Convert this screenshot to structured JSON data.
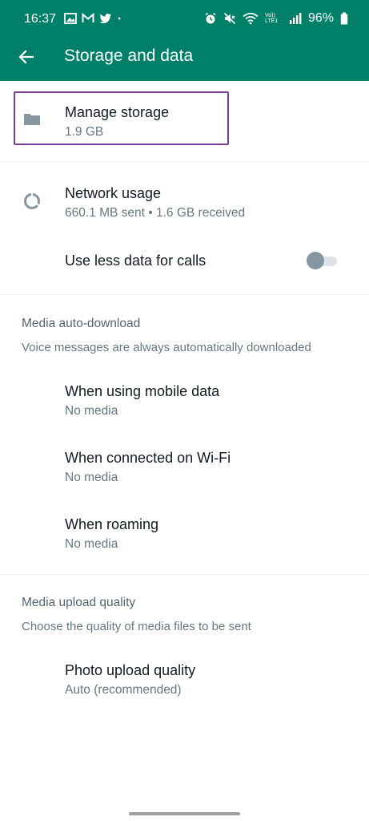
{
  "status_bar": {
    "time": "16:37",
    "battery": "96%",
    "left_icons": [
      "image-icon",
      "gmail-icon",
      "twitter-icon",
      "dot-icon"
    ],
    "right_icons": [
      "alarm-icon",
      "mute-icon",
      "wifi-icon",
      "volte-icon",
      "signal-icon",
      "battery-icon"
    ],
    "volte_label": "Vo)) LTE1"
  },
  "app_bar": {
    "title": "Storage and data",
    "back_icon": "arrow-left-icon"
  },
  "colors": {
    "brand": "#008069",
    "highlight": "#7d3c98",
    "icon": "#8696a0",
    "primary_text": "#111b21",
    "secondary_text": "#667781"
  },
  "manage_storage": {
    "title": "Manage storage",
    "subtitle": "1.9 GB",
    "icon": "folder-icon"
  },
  "network_usage": {
    "title": "Network usage",
    "subtitle": "660.1 MB sent • 1.6 GB received",
    "icon": "data-usage-icon"
  },
  "less_data": {
    "title": "Use less data for calls",
    "enabled": false
  },
  "media_auto_download": {
    "header": "Media auto-download",
    "description": "Voice messages are always automatically downloaded",
    "items": [
      {
        "title": "When using mobile data",
        "subtitle": "No media"
      },
      {
        "title": "When connected on Wi-Fi",
        "subtitle": "No media"
      },
      {
        "title": "When roaming",
        "subtitle": "No media"
      }
    ]
  },
  "media_upload_quality": {
    "header": "Media upload quality",
    "description": "Choose the quality of media files to be sent",
    "items": [
      {
        "title": "Photo upload quality",
        "subtitle": "Auto (recommended)"
      }
    ]
  }
}
